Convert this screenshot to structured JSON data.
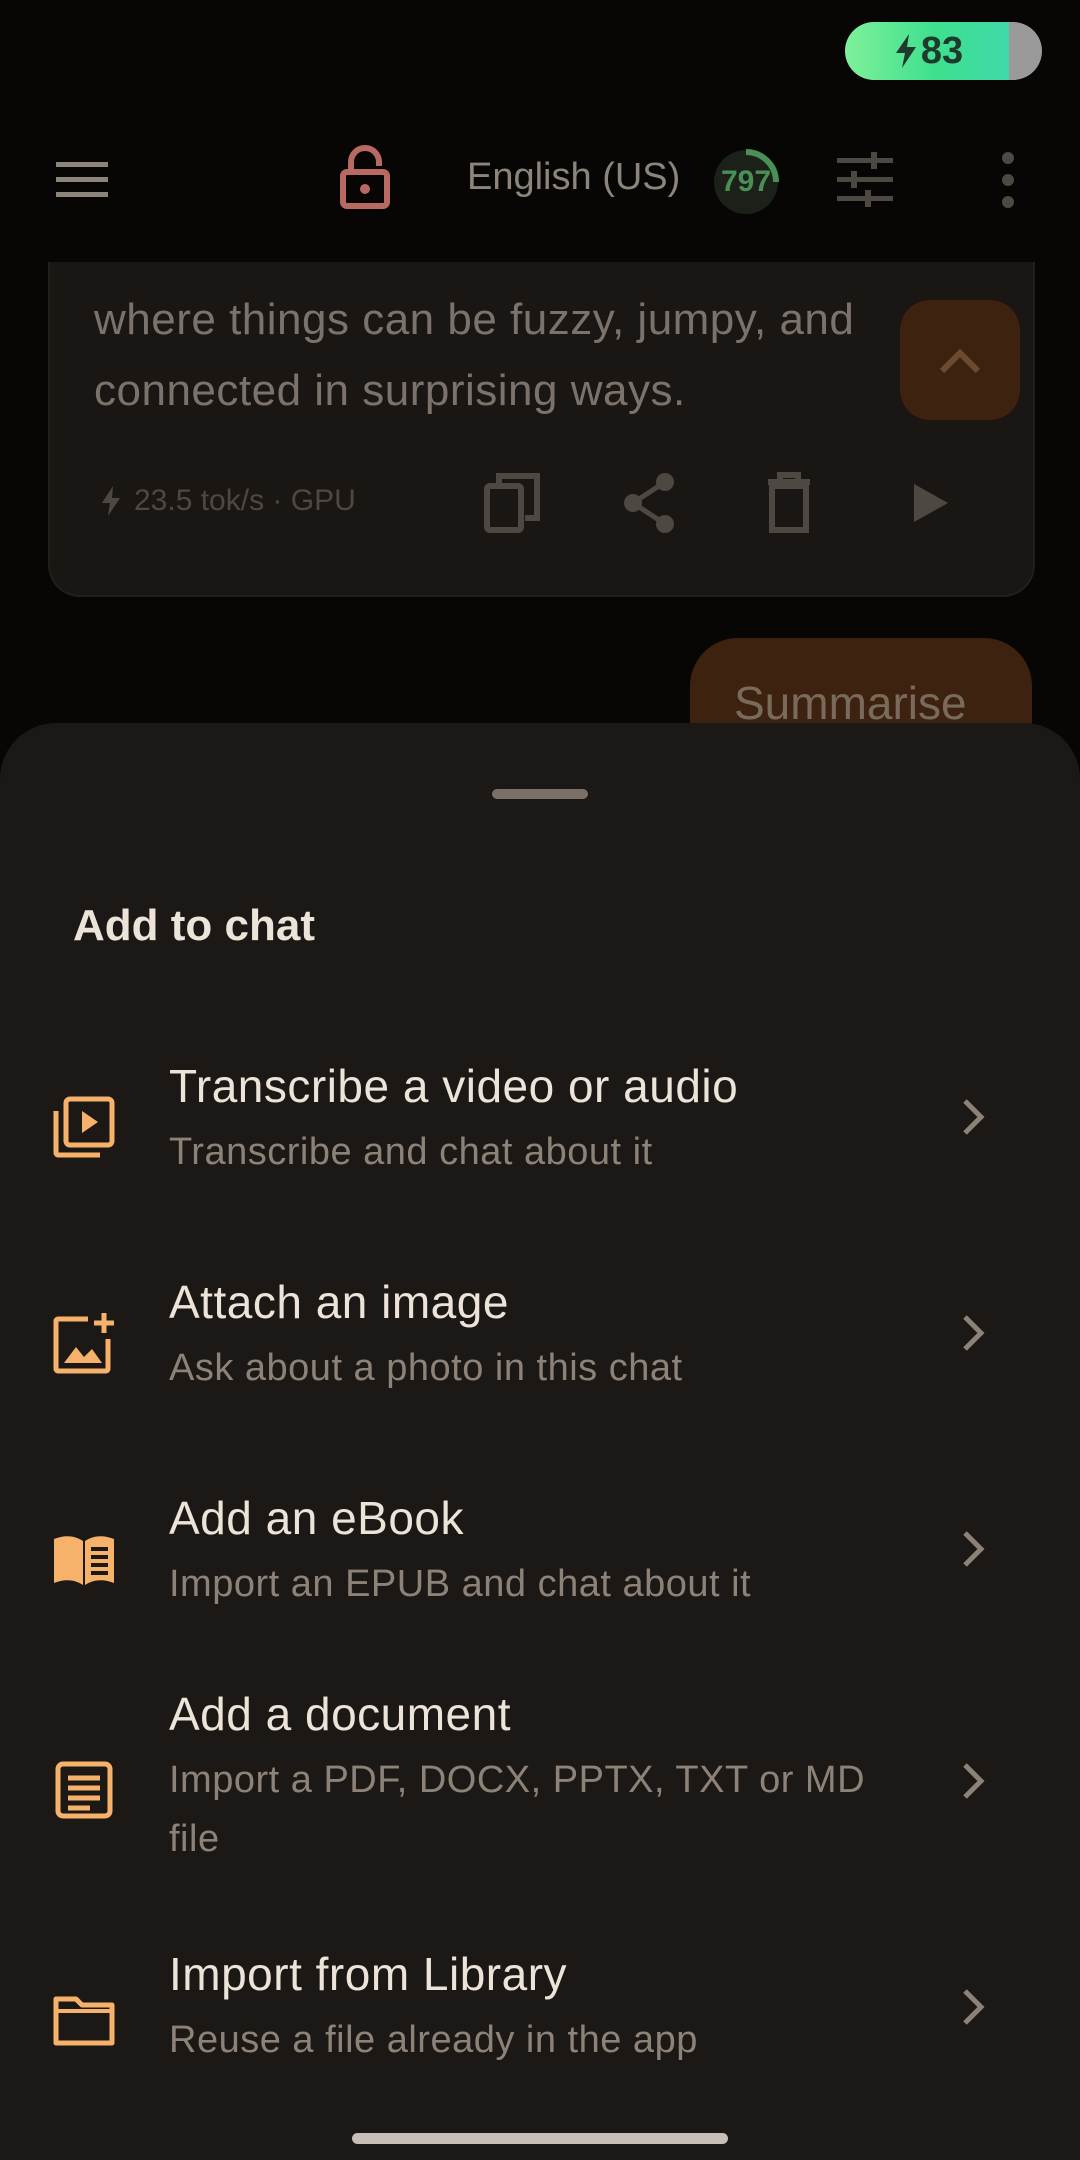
{
  "status_bar": {
    "battery_level": "83",
    "battery_fraction": 0.83
  },
  "app_bar": {
    "language": "English (US)",
    "progress_value": "797"
  },
  "message": {
    "text": "where things can be fuzzy, jumpy, and connected in surprising ways.",
    "stats": "23.5 tok/s · GPU"
  },
  "suggestion_chip": "Summarise",
  "sheet": {
    "title": "Add to chat",
    "options": [
      {
        "icon": "video-library-icon",
        "title": "Transcribe a video or audio",
        "subtitle": "Transcribe and chat about it"
      },
      {
        "icon": "add-photo-icon",
        "title": "Attach an image",
        "subtitle": "Ask about a photo in this chat"
      },
      {
        "icon": "book-icon",
        "title": "Add an eBook",
        "subtitle": "Import an EPUB and chat about it"
      },
      {
        "icon": "document-icon",
        "title": "Add a document",
        "subtitle": "Import a PDF, DOCX, PPTX, TXT or MD file"
      },
      {
        "icon": "folder-icon",
        "title": "Import from Library",
        "subtitle": "Reuse a file already in the app"
      }
    ]
  },
  "colors": {
    "accent": "#f6b26b",
    "sheet_background": "#1c1815",
    "battery_fill": "#3ee08e"
  }
}
